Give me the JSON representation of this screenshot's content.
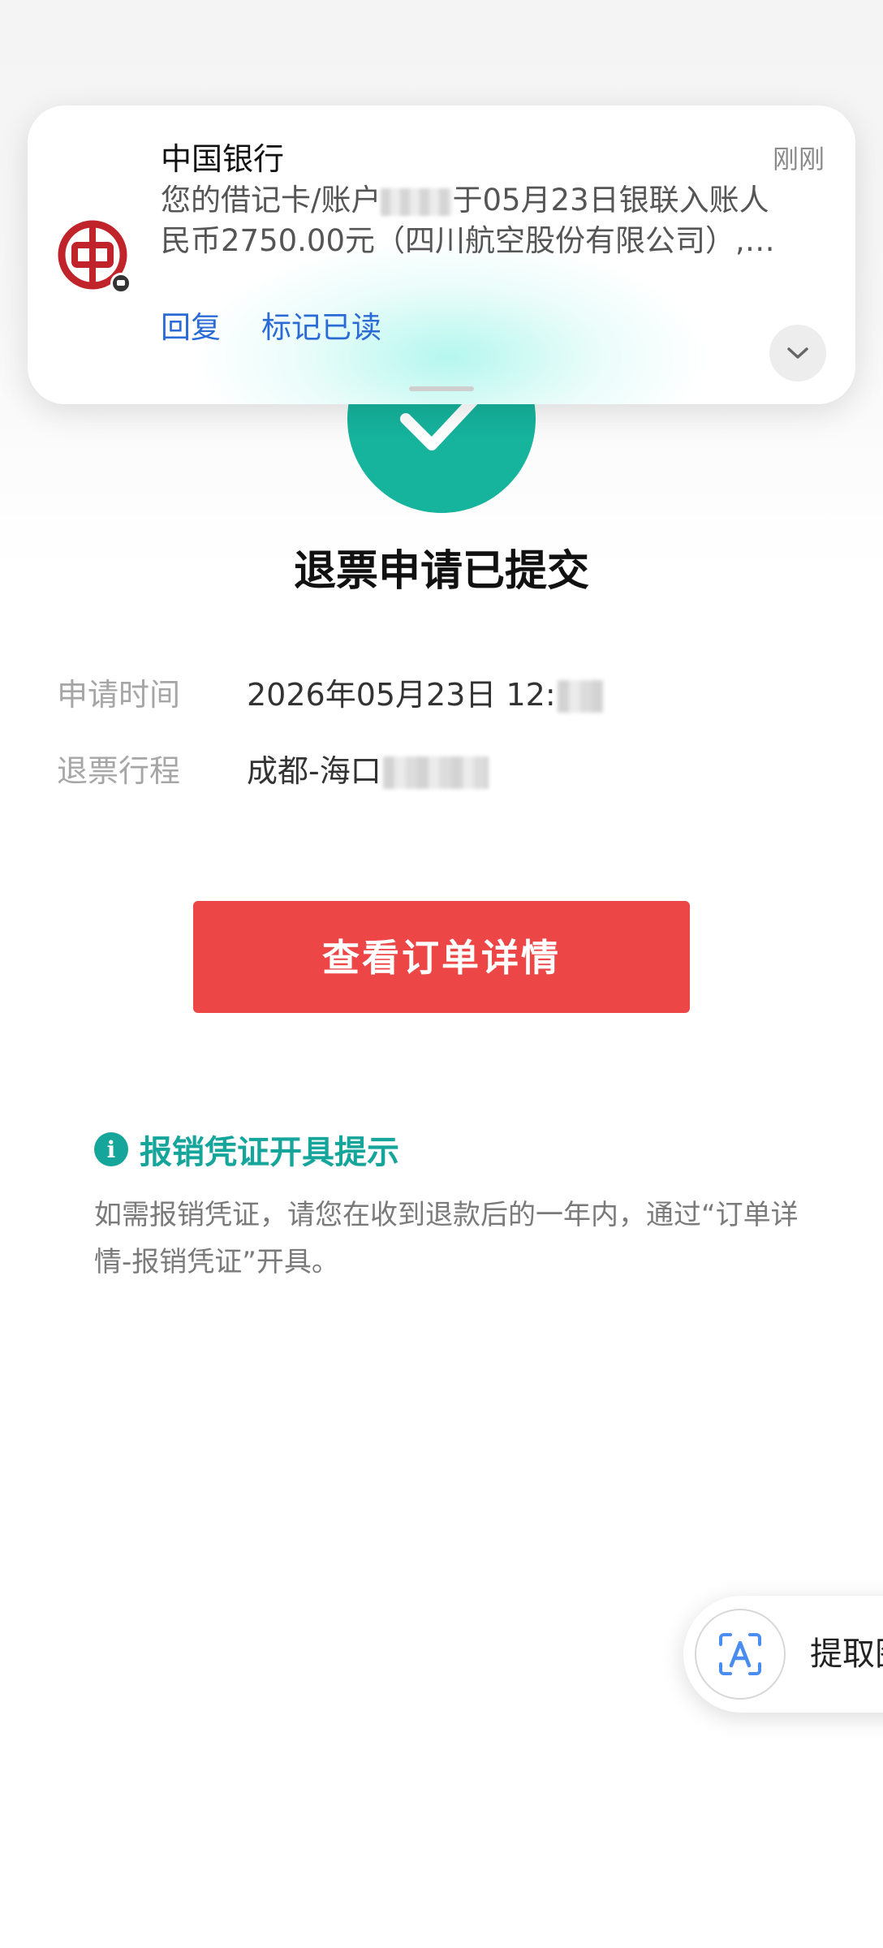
{
  "notification": {
    "app_name": "中国银行",
    "time": "刚刚",
    "body_line1_prefix": "您的借记卡/账户",
    "body_line1_suffix": "于05月23日银联入账人",
    "body_line2": "民币2750.00元（四川航空股份有限公司）,…",
    "actions": [
      "回复",
      "标记已读"
    ],
    "icons": {
      "logo": "bank-of-china-logo",
      "expand": "chevron-down-icon"
    }
  },
  "result": {
    "title": "退票申请已提交",
    "status_icon": "checkmark-icon",
    "accent_color": "#16b39d"
  },
  "details": [
    {
      "label": "申请时间",
      "value": "2026年05月23日 12:"
    },
    {
      "label": "退票行程",
      "value": "成都-海口"
    }
  ],
  "primary_button": {
    "label": "查看订单详情",
    "color": "#ec4646"
  },
  "tip": {
    "title": "报销凭证开具提示",
    "icon": "info-icon",
    "body": "如需报销凭证，请您在收到退款后的一年内，通过“订单详情-报销凭证”开具。",
    "color": "#16a59a"
  },
  "floating_tool": {
    "label": "提取图",
    "icon": "text-extract-icon"
  }
}
